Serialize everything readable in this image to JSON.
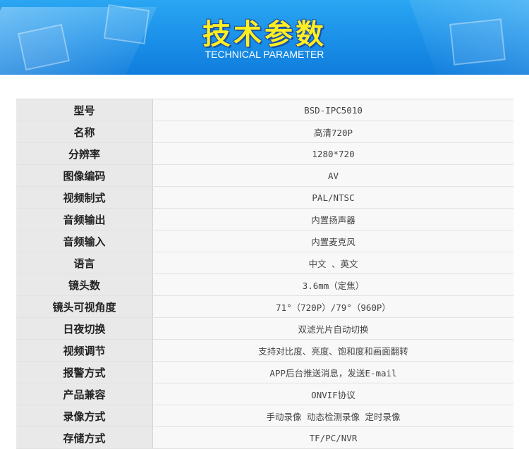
{
  "banner": {
    "title": "技术参数",
    "subtitle": "TECHNICAL PARAMETER"
  },
  "specs": [
    {
      "key": "型号",
      "value": "BSD-IPC5010"
    },
    {
      "key": "名称",
      "value": "高清720P"
    },
    {
      "key": "分辨率",
      "value": "1280*720"
    },
    {
      "key": "图像编码",
      "value": "AV"
    },
    {
      "key": "视频制式",
      "value": "PAL/NTSC"
    },
    {
      "key": "音频输出",
      "value": "内置扬声器"
    },
    {
      "key": "音频输入",
      "value": "内置麦克风"
    },
    {
      "key": "语言",
      "value": "中文 、英文"
    },
    {
      "key": "镜头数",
      "value": "3.6mm（定焦）"
    },
    {
      "key": "镜头可视角度",
      "value": "71°（720P）/79°（960P）"
    },
    {
      "key": "日夜切换",
      "value": "双滤光片自动切换"
    },
    {
      "key": "视频调节",
      "value": "支持对比度、亮度、饱和度和画面翻转"
    },
    {
      "key": "报警方式",
      "value": "APP后台推送消息，发送E-mail"
    },
    {
      "key": "产品兼容",
      "value": "ONVIF协议"
    },
    {
      "key": "录像方式",
      "value": "手动录像  动态检测录像  定时录像"
    },
    {
      "key": "存储方式",
      "value": "TF/PC/NVR"
    }
  ]
}
